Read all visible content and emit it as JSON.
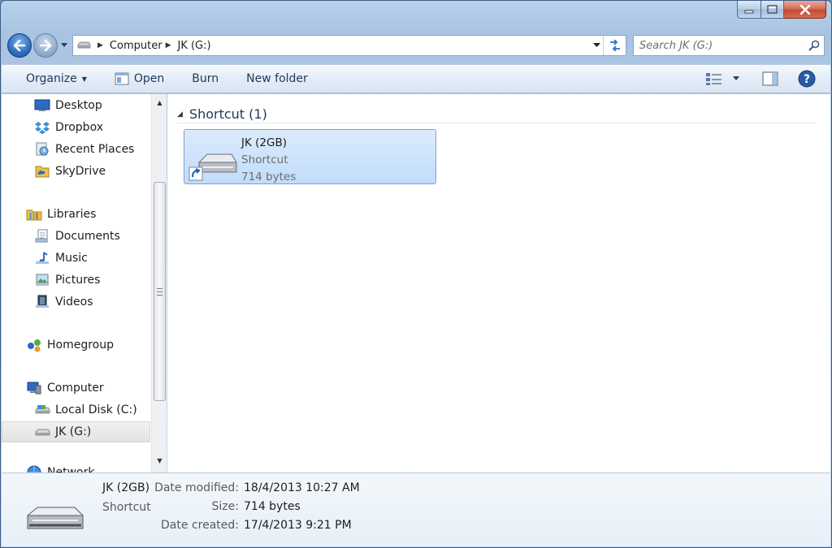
{
  "window": {
    "controls": {
      "minimize": "minimize",
      "maximize": "maximize",
      "close": "close"
    }
  },
  "address": {
    "crumbs": [
      {
        "label": "Computer"
      },
      {
        "label": "JK (G:)"
      }
    ],
    "search_placeholder": "Search JK (G:)"
  },
  "toolbar": {
    "organize": "Organize",
    "open": "Open",
    "burn": "Burn",
    "new_folder": "New folder"
  },
  "nav": {
    "favorites": [
      {
        "label": "Desktop",
        "icon": "desktop-icon"
      },
      {
        "label": "Dropbox",
        "icon": "dropbox-icon"
      },
      {
        "label": "Recent Places",
        "icon": "recent-places-icon"
      },
      {
        "label": "SkyDrive",
        "icon": "skydrive-icon"
      }
    ],
    "libraries": {
      "label": "Libraries",
      "icon": "libraries-icon"
    },
    "library_items": [
      {
        "label": "Documents",
        "icon": "documents-icon"
      },
      {
        "label": "Music",
        "icon": "music-icon"
      },
      {
        "label": "Pictures",
        "icon": "pictures-icon"
      },
      {
        "label": "Videos",
        "icon": "videos-icon"
      }
    ],
    "homegroup": {
      "label": "Homegroup",
      "icon": "homegroup-icon"
    },
    "computer": {
      "label": "Computer",
      "icon": "computer-icon"
    },
    "drives": [
      {
        "label": "Local Disk (C:)",
        "icon": "local-disk-icon"
      },
      {
        "label": "JK (G:)",
        "icon": "usb-drive-icon",
        "selected": true
      }
    ],
    "network_partial": "Network"
  },
  "content": {
    "group_title": "Shortcut (1)",
    "item": {
      "name": "JK (2GB)",
      "type": "Shortcut",
      "size": "714 bytes"
    }
  },
  "details": {
    "name": "JK (2GB)",
    "type": "Shortcut",
    "fields": [
      {
        "label": "Date modified:",
        "value": "18/4/2013 10:27 AM"
      },
      {
        "label": "Size:",
        "value": "714 bytes"
      },
      {
        "label": "Date created:",
        "value": "17/4/2013 9:21 PM"
      }
    ]
  },
  "colors": {
    "accent": "#1e395b",
    "selection": "#c1dcfc",
    "selection_border": "#7da2ce"
  }
}
